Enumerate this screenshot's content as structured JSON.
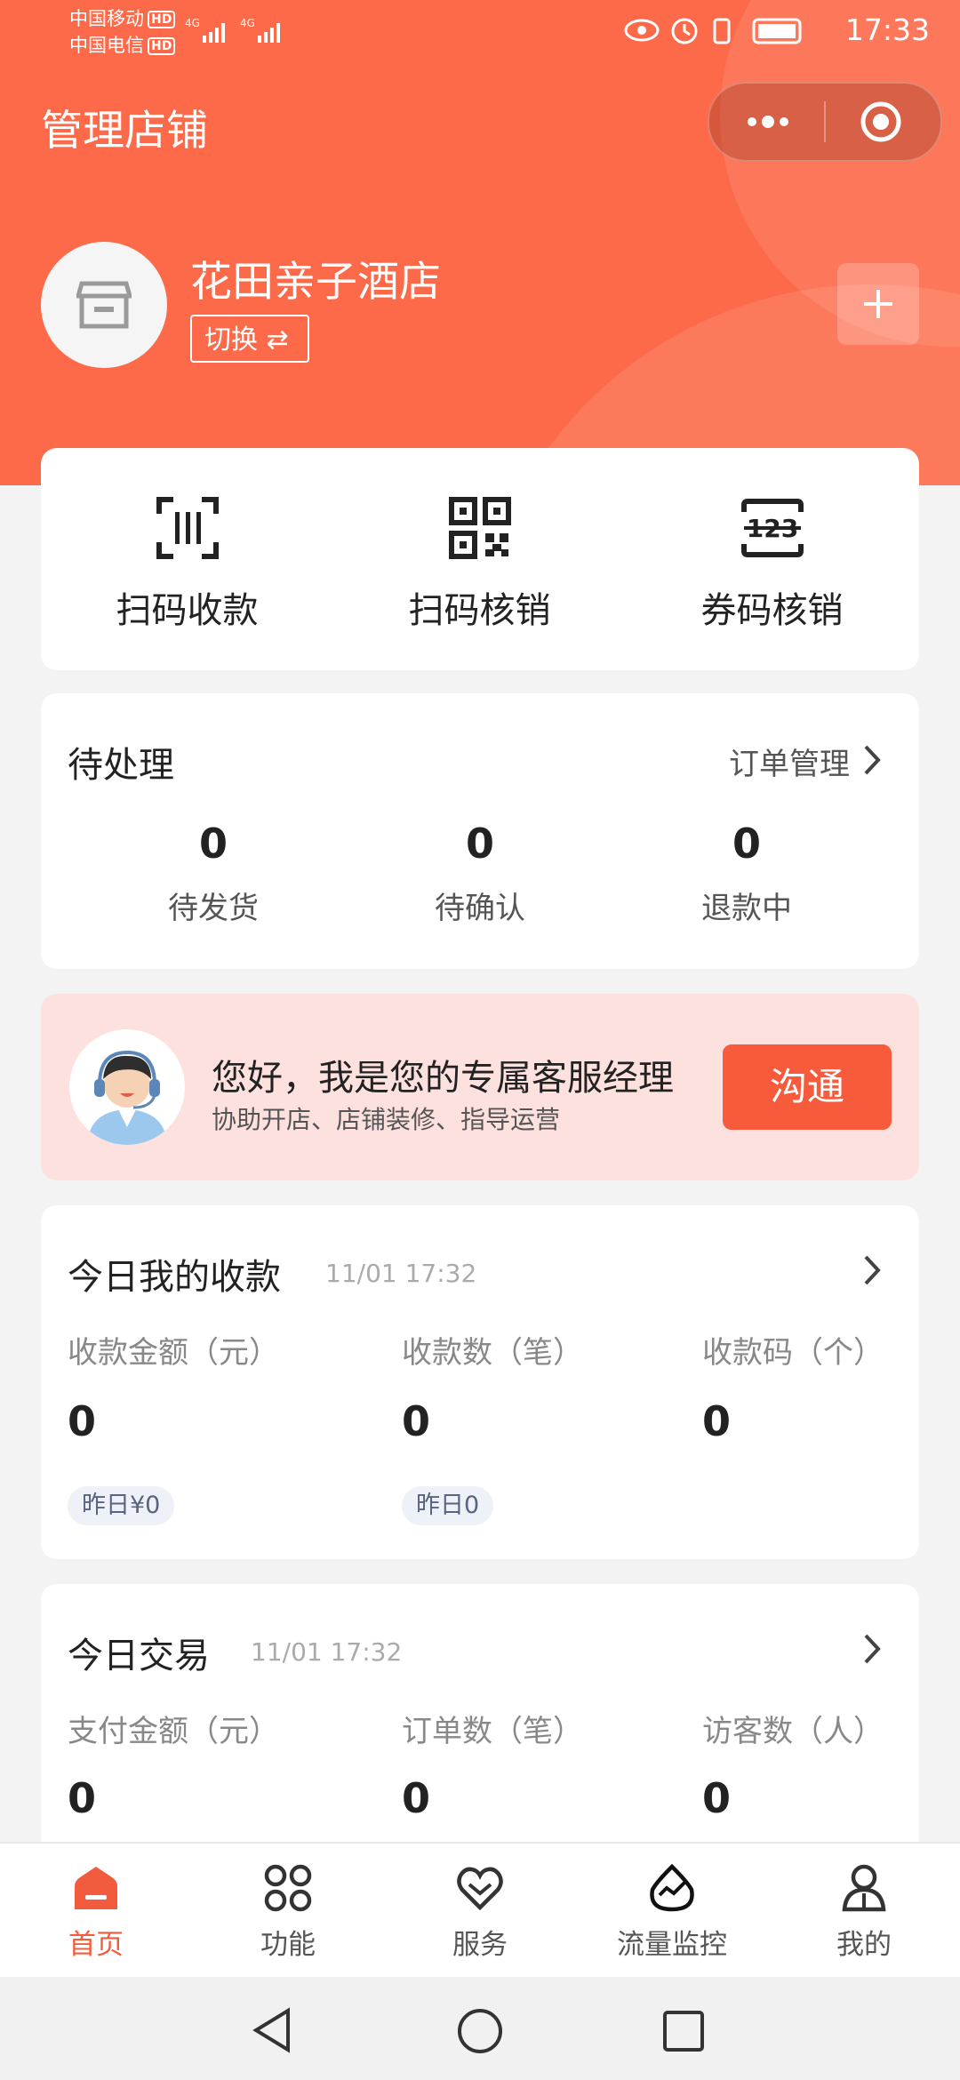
{
  "status_bar": {
    "carrier1": "中国移动",
    "carrier2": "中国电信",
    "hd": "HD",
    "net": "4G",
    "time": "17:33"
  },
  "header": {
    "title": "管理店铺"
  },
  "store": {
    "name": "花田亲子酒店",
    "switch_label": "切换 ⇄"
  },
  "quick_actions": [
    {
      "label": "扫码收款",
      "icon": "scan-barcode-icon"
    },
    {
      "label": "扫码核销",
      "icon": "qr-code-icon"
    },
    {
      "label": "券码核销",
      "icon": "code-123-icon"
    }
  ],
  "pending": {
    "title": "待处理",
    "link": "订单管理",
    "items": [
      {
        "value": "0",
        "label": "待发货"
      },
      {
        "value": "0",
        "label": "待确认"
      },
      {
        "value": "0",
        "label": "退款中"
      }
    ]
  },
  "service": {
    "title": "您好，我是您的专属客服经理",
    "subtitle": "协助开店、店铺装修、指导运营",
    "button": "沟通"
  },
  "today_collection": {
    "title": "今日我的收款",
    "time": "11/01 17:32",
    "metrics": [
      {
        "label": "收款金额（元）",
        "value": "0",
        "yesterday": "昨日¥0"
      },
      {
        "label": "收款数（笔）",
        "value": "0",
        "yesterday": "昨日0"
      },
      {
        "label": "收款码（个）",
        "value": "0"
      }
    ]
  },
  "today_trade": {
    "title": "今日交易",
    "time": "11/01 17:32",
    "metrics": [
      {
        "label": "支付金额（元）",
        "value": "0"
      },
      {
        "label": "订单数（笔）",
        "value": "0"
      },
      {
        "label": "访客数（人）",
        "value": "0"
      }
    ]
  },
  "tabs": [
    {
      "label": "首页",
      "icon": "home-icon",
      "active": true
    },
    {
      "label": "功能",
      "icon": "grid-icon"
    },
    {
      "label": "服务",
      "icon": "heart-icon"
    },
    {
      "label": "流量监控",
      "icon": "traffic-monitor-icon"
    },
    {
      "label": "我的",
      "icon": "user-icon"
    }
  ],
  "colors": {
    "brand": "#fd6a4a",
    "button": "#f85a3c",
    "banner_bg": "#fde1de"
  }
}
